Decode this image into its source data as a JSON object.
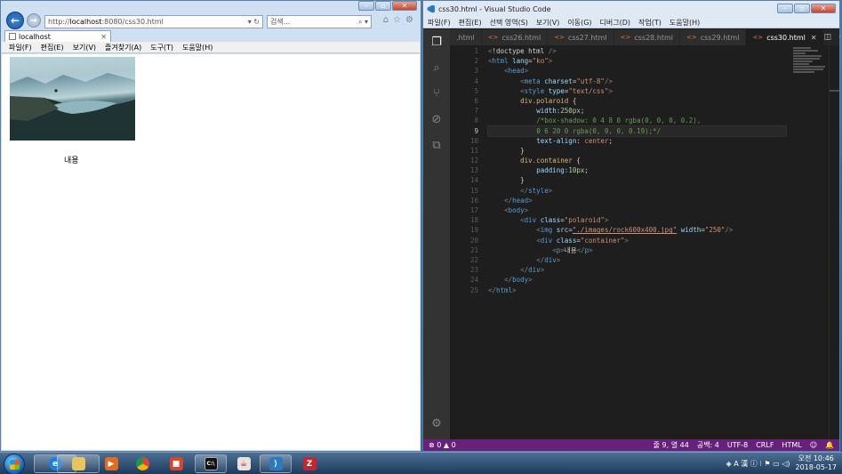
{
  "ie": {
    "address_prefix": "http://",
    "address_host": "localhost",
    "address_rest": ":8080/css30.html",
    "address_tail": "▾ ↻",
    "search_placeholder": "검색...",
    "search_tail": "⌕ ▾",
    "tab_label": "localhost",
    "tab_close": "✕",
    "menu": [
      "파일(F)",
      "편집(E)",
      "보기(V)",
      "즐겨찾기(A)",
      "도구(T)",
      "도움말(H)"
    ],
    "page_caption": "내용"
  },
  "vscode": {
    "window_title": "css30.html - Visual Studio Code",
    "menu": [
      "파일(F)",
      "편집(E)",
      "선택 영역(S)",
      "보기(V)",
      "이동(G)",
      "디버그(D)",
      "작업(T)",
      "도움말(H)"
    ],
    "tabs": [
      ".html",
      "css26.html",
      "css27.html",
      "css28.html",
      "css29.html",
      "css30.html"
    ],
    "active_tab": "css30.html",
    "current_line": 9,
    "code_lines": [
      [
        [
          "t-ang",
          "<"
        ],
        [
          "t-txt",
          "!doctype html "
        ],
        [
          "t-ang",
          "/>"
        ]
      ],
      [
        [
          "t-ang",
          "<"
        ],
        [
          "t-tag",
          "html "
        ],
        [
          "t-attr",
          "lang"
        ],
        [
          "t-txt",
          "="
        ],
        [
          "t-str",
          "\"ko\""
        ],
        [
          "t-ang",
          ">"
        ]
      ],
      [
        [
          "t-txt",
          "    "
        ],
        [
          "t-ang",
          "<"
        ],
        [
          "t-tag",
          "head"
        ],
        [
          "t-ang",
          ">"
        ]
      ],
      [
        [
          "t-txt",
          "        "
        ],
        [
          "t-ang",
          "<"
        ],
        [
          "t-tag",
          "meta "
        ],
        [
          "t-attr",
          "charset"
        ],
        [
          "t-txt",
          "="
        ],
        [
          "t-str",
          "\"utf-8\""
        ],
        [
          "t-ang",
          "/>"
        ]
      ],
      [
        [
          "t-txt",
          "        "
        ],
        [
          "t-ang",
          "<"
        ],
        [
          "t-tag",
          "style "
        ],
        [
          "t-attr",
          "type"
        ],
        [
          "t-txt",
          "="
        ],
        [
          "t-str",
          "\"text/css\""
        ],
        [
          "t-ang",
          ">"
        ]
      ],
      [
        [
          "t-txt",
          "        "
        ],
        [
          "t-sel",
          "div.polaroid"
        ],
        [
          "t-txt",
          " {"
        ]
      ],
      [
        [
          "t-txt",
          "            "
        ],
        [
          "t-prop",
          "width"
        ],
        [
          "t-txt",
          ":"
        ],
        [
          "t-val",
          "250px"
        ],
        [
          "t-txt",
          ";"
        ]
      ],
      [
        [
          "t-txt",
          "            "
        ],
        [
          "t-com",
          "/*box-shadow: 0 4 8 0 rgba(0, 0, 0, 0.2),"
        ]
      ],
      [
        [
          "t-txt",
          "            "
        ],
        [
          "t-com",
          "0 6 20 0 rgba(0, 0, 0, 0.19);*/"
        ]
      ],
      [
        [
          "t-txt",
          "            "
        ],
        [
          "t-prop",
          "text-align"
        ],
        [
          "t-txt",
          ": "
        ],
        [
          "t-str",
          "center"
        ],
        [
          "t-txt",
          ";"
        ]
      ],
      [
        [
          "t-txt",
          "        }"
        ]
      ],
      [
        [
          "t-txt",
          "        "
        ],
        [
          "t-sel",
          "div.container"
        ],
        [
          "t-txt",
          " {"
        ]
      ],
      [
        [
          "t-txt",
          "            "
        ],
        [
          "t-prop",
          "padding"
        ],
        [
          "t-txt",
          ":"
        ],
        [
          "t-val",
          "10px"
        ],
        [
          "t-txt",
          ";"
        ]
      ],
      [
        [
          "t-txt",
          "        }"
        ]
      ],
      [
        [
          "t-txt",
          "        "
        ],
        [
          "t-ang",
          "</"
        ],
        [
          "t-tag",
          "style"
        ],
        [
          "t-ang",
          ">"
        ]
      ],
      [
        [
          "t-txt",
          "    "
        ],
        [
          "t-ang",
          "</"
        ],
        [
          "t-tag",
          "head"
        ],
        [
          "t-ang",
          ">"
        ]
      ],
      [
        [
          "t-txt",
          "    "
        ],
        [
          "t-ang",
          "<"
        ],
        [
          "t-tag",
          "body"
        ],
        [
          "t-ang",
          ">"
        ]
      ],
      [
        [
          "t-txt",
          "        "
        ],
        [
          "t-ang",
          "<"
        ],
        [
          "t-tag",
          "div "
        ],
        [
          "t-attr",
          "class"
        ],
        [
          "t-txt",
          "="
        ],
        [
          "t-str",
          "\"polaroid\""
        ],
        [
          "t-ang",
          ">"
        ]
      ],
      [
        [
          "t-txt",
          "            "
        ],
        [
          "t-ang",
          "<"
        ],
        [
          "t-tag",
          "img "
        ],
        [
          "t-attr",
          "src"
        ],
        [
          "t-txt",
          "="
        ],
        [
          "t-str t-link",
          "\"./images/rock600x400.jpg\""
        ],
        [
          "t-txt",
          " "
        ],
        [
          "t-attr",
          "width"
        ],
        [
          "t-txt",
          "="
        ],
        [
          "t-str",
          "\"250\""
        ],
        [
          "t-ang",
          "/>"
        ]
      ],
      [
        [
          "t-txt",
          "            "
        ],
        [
          "t-ang",
          "<"
        ],
        [
          "t-tag",
          "div "
        ],
        [
          "t-attr",
          "class"
        ],
        [
          "t-txt",
          "="
        ],
        [
          "t-str",
          "\"container\""
        ],
        [
          "t-ang",
          ">"
        ]
      ],
      [
        [
          "t-txt",
          "                "
        ],
        [
          "t-ang",
          "<"
        ],
        [
          "t-tag",
          "p"
        ],
        [
          "t-ang",
          ">"
        ],
        [
          "t-txt",
          "내용"
        ],
        [
          "t-ang",
          "</"
        ],
        [
          "t-tag",
          "p"
        ],
        [
          "t-ang",
          ">"
        ]
      ],
      [
        [
          "t-txt",
          "            "
        ],
        [
          "t-ang",
          "</"
        ],
        [
          "t-tag",
          "div"
        ],
        [
          "t-ang",
          ">"
        ]
      ],
      [
        [
          "t-txt",
          "        "
        ],
        [
          "t-ang",
          "</"
        ],
        [
          "t-tag",
          "div"
        ],
        [
          "t-ang",
          ">"
        ]
      ],
      [
        [
          "t-txt",
          "    "
        ],
        [
          "t-ang",
          "</"
        ],
        [
          "t-tag",
          "body"
        ],
        [
          "t-ang",
          ">"
        ]
      ],
      [
        [
          "t-ang",
          "</"
        ],
        [
          "t-tag",
          "html"
        ],
        [
          "t-ang",
          ">"
        ]
      ]
    ],
    "status": {
      "problems": "⊗ 0 ▲ 0",
      "position": "줄 9, 열 44",
      "spaces": "공백: 4",
      "encoding": "UTF-8",
      "eol": "CRLF",
      "language": "HTML",
      "smiley": "☺",
      "bell": "🔔"
    }
  },
  "taskbar": {
    "tray_icons": "◈ A 漢 ⓘ ⁝ ⚑ ▭ ◁)",
    "time": "오전 10:46",
    "date": "2018-05-17"
  },
  "colors": {
    "vscode_status": "#68217a",
    "ie_back": "#1b5aa8"
  }
}
